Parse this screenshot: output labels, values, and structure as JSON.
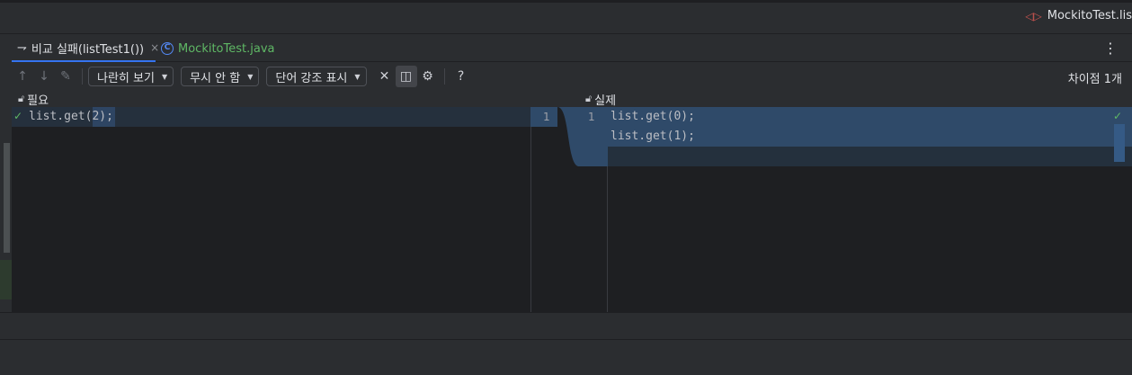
{
  "run_tab": {
    "icon": "diff-arrows-icon",
    "label": "MockitoTest.lis"
  },
  "tabs": [
    {
      "label": "비교 실패(listTest1())",
      "close": "×",
      "active": true
    },
    {
      "label": "MockitoTest.java",
      "active": false
    }
  ],
  "toolbar": {
    "viewer_mode": "나란히 보기",
    "ignore_mode": "무시 안 함",
    "highlight_mode": "단어 강조 표시",
    "help": "?",
    "diff_count": "차이점 1개"
  },
  "left_pane": {
    "title": "필요",
    "lines": [
      "list.get(2);"
    ]
  },
  "right_pane": {
    "title": "실제",
    "lines": [
      "list.get(0);",
      "list.get(1);"
    ]
  },
  "gutter": {
    "left_number": "1",
    "right_number": "1"
  },
  "colors": {
    "accent": "#3574f0",
    "inserted_bg": "#2f4a69",
    "ok_green": "#5fb865"
  }
}
